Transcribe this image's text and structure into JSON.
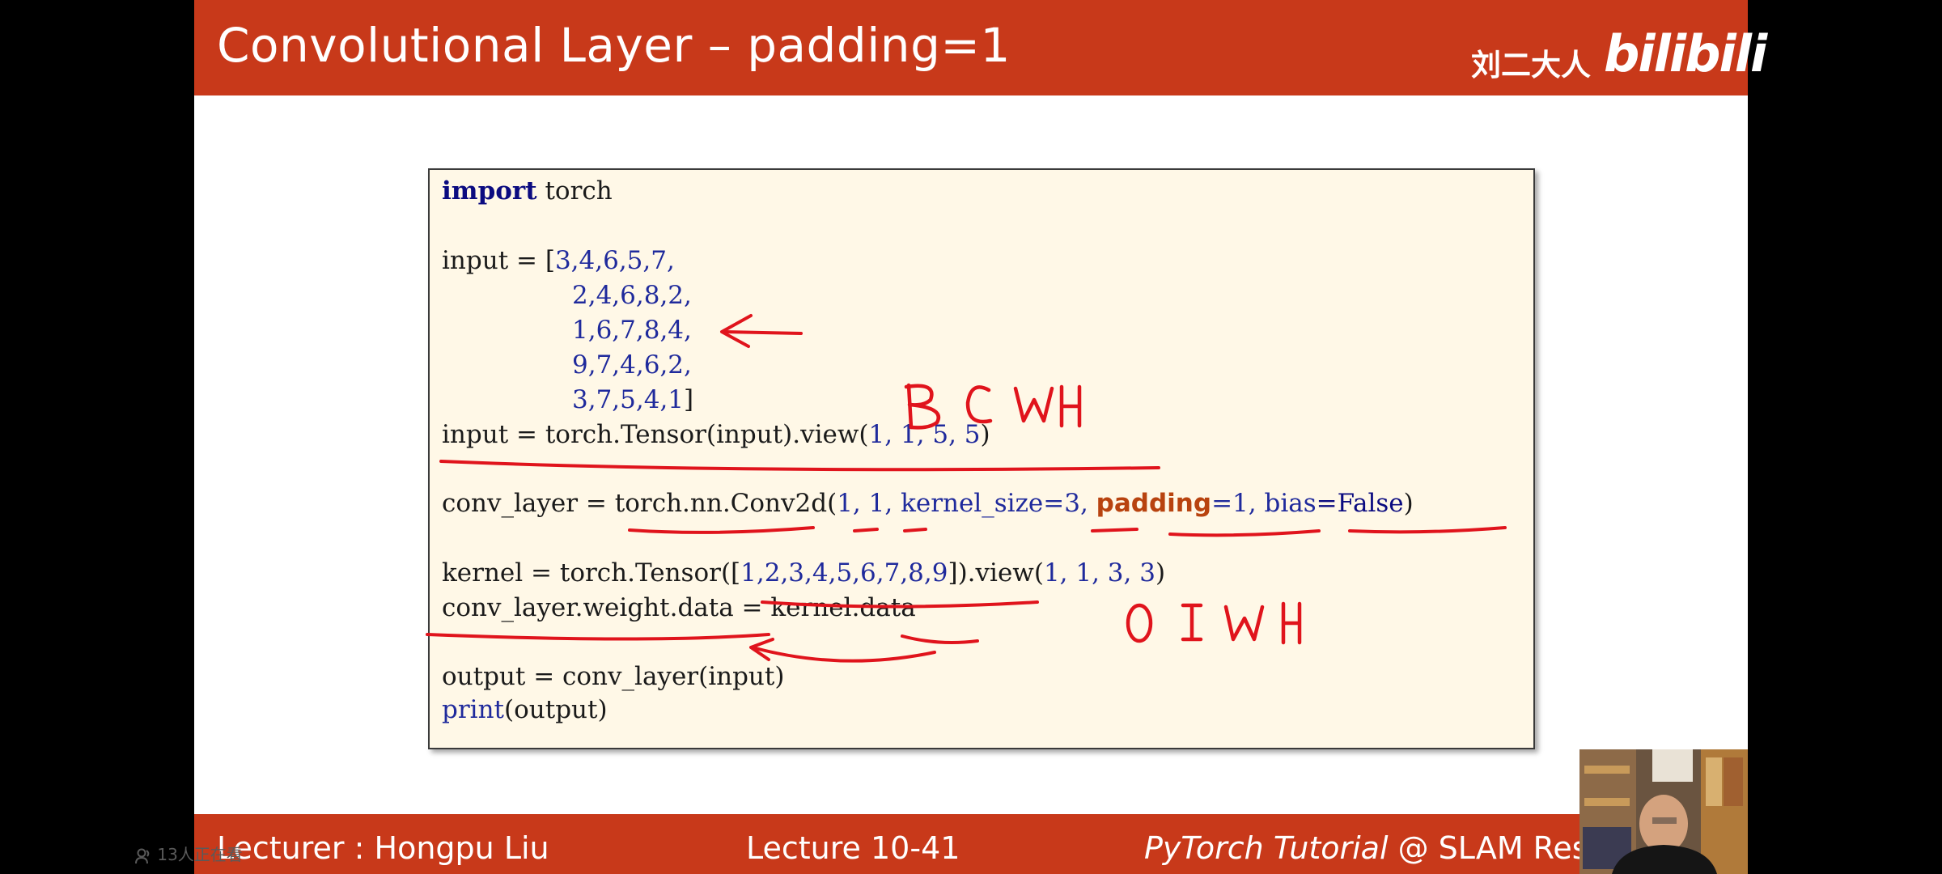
{
  "slide": {
    "title": "Convolutional Layer – padding=1",
    "channel_name": "刘二大人",
    "brand_logo": "bilibili",
    "accent_color": "#c8391a",
    "code_background": "#fff8e7"
  },
  "code": {
    "line1_kw": "import",
    "line1_rest": " torch",
    "line3_a": "input = [",
    "line3_nums": "3,4,6,5,7,",
    "line4_nums": "2,4,6,8,2,",
    "line5_nums": "1,6,7,8,4,",
    "line6_nums": "9,7,4,6,2,",
    "line7_nums": "3,7,5,4,1",
    "line7_close": "]",
    "line8_a": "input = torch.Tensor(input).view(",
    "line8_args": "1, 1, 5, 5",
    "line8_close": ")",
    "line10_a": "conv_layer = torch.nn.Conv2d(",
    "line10_args": "1, 1, ",
    "line10_ks": "kernel_size",
    "line10_ksval": "=3, ",
    "line10_pad": "padding",
    "line10_padval": "=1, ",
    "line10_bias": "bias",
    "line10_biasval": "=False",
    "line10_close": ")",
    "line12_a": "kernel = torch.Tensor([",
    "line12_nums": "1,2,3,4,5,6,7,8,9",
    "line12_b": "]).view(",
    "line12_args": "1, 1, 3, 3",
    "line12_close": ")",
    "line13": "conv_layer.weight.data = kernel.data",
    "line15": "output = conv_layer(input)",
    "line16_fn": "print",
    "line16_rest": "(output)"
  },
  "annotations": {
    "handwritten_top": "B C W H",
    "handwritten_bottom": "O I W H",
    "ink_color": "#e0141c"
  },
  "footer": {
    "lecturer": "Lecturer : Hongpu Liu",
    "lecture": "Lecture 10-41",
    "course_italic": "PyTorch Tutorial",
    "course_rest": " @ SLAM Resea"
  },
  "overlay": {
    "viewer_count": "13人正在看"
  }
}
